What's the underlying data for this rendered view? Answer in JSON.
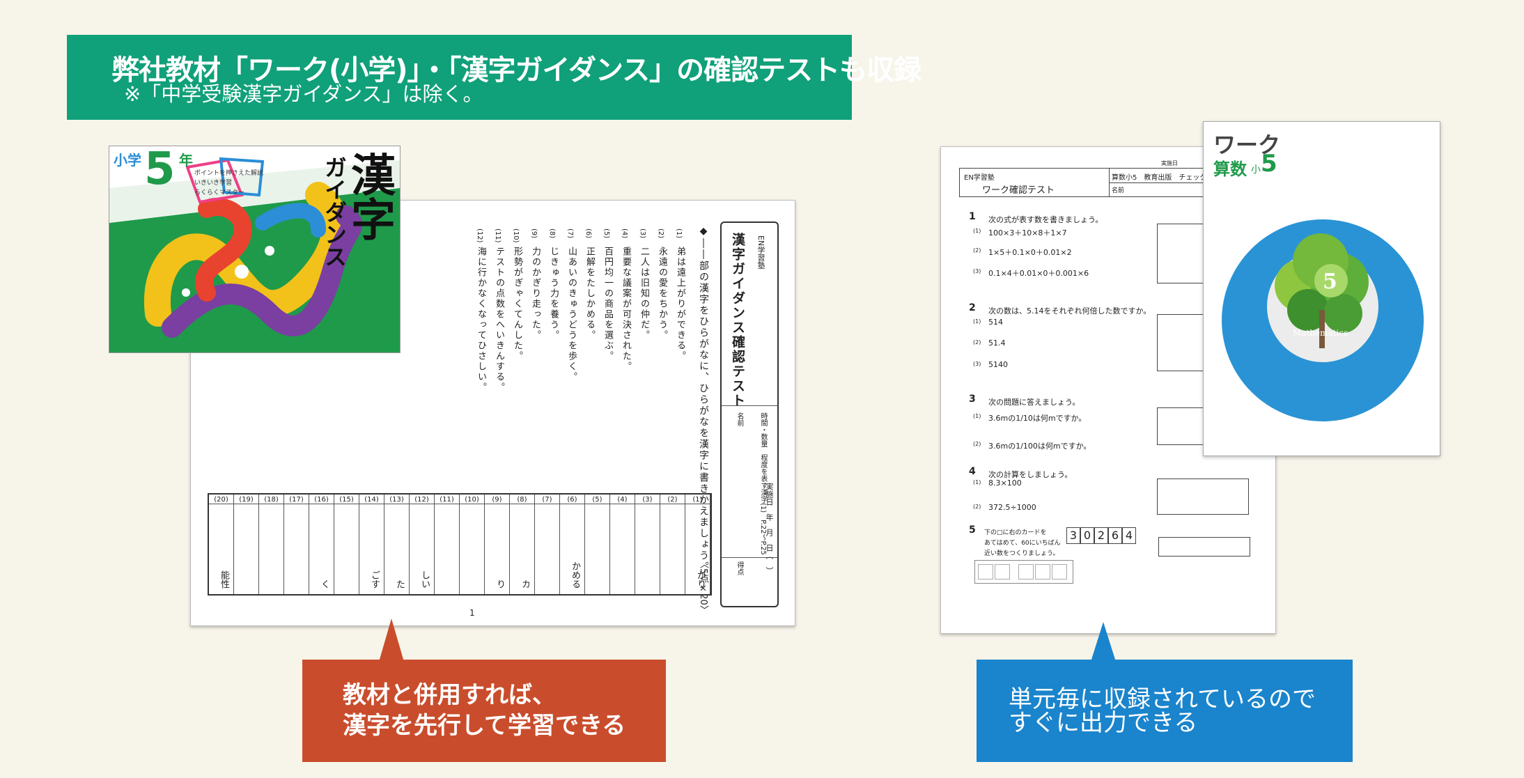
{
  "banner": {
    "title": "弊社教材「ワーク(小学)」・「漢字ガイダンス」の確認テストも収録",
    "note": "※「中学受験漢字ガイダンス」は除く。"
  },
  "kanji_book": {
    "grade_label": "小学",
    "grade_number": "5",
    "grade_suffix": "年",
    "title_main": "漢字",
    "title_sub": "ガイダンス",
    "points": [
      "ポイントを押さえた解説",
      "いきいき学習",
      "らくらくマスター"
    ]
  },
  "kanji_test": {
    "publisher": "EN学習塾",
    "title": "漢字ガイダンス確認テスト",
    "instruction": "◆――部の漢字をひらがなに、ひらがなを漢字に書きかえましょう。",
    "score_note": "〈5点×20〉",
    "name_label": "名前",
    "points_label": "得点",
    "date_label": "実施日　年　月　日（　）",
    "range_label": "時間・数量　程度を表す漢字(1)　P.22〜P.25",
    "page_number": "1",
    "questions": [
      {
        "num": "(1)",
        "text": "弟は遠上がりができる。"
      },
      {
        "num": "(2)",
        "text": "永遠の愛をちかう。"
      },
      {
        "num": "(3)",
        "text": "二人は旧知の仲だ。"
      },
      {
        "num": "(4)",
        "text": "重要な議案が可決された。"
      },
      {
        "num": "(5)",
        "text": "百円均一の商品を選ぶ。"
      },
      {
        "num": "(6)",
        "text": "正解をたしかめる。"
      },
      {
        "num": "(7)",
        "text": "山あいのきゅうどうを歩く。"
      },
      {
        "num": "(8)",
        "text": "じきゅう力を養う。"
      },
      {
        "num": "(9)",
        "text": "力のかぎり走った。"
      },
      {
        "num": "(10)",
        "text": "形勢がぎゃくてんした。"
      },
      {
        "num": "(11)",
        "text": "テストの点数をへいきんする。"
      },
      {
        "num": "(12)",
        "text": "海に行かなくなってひさしい。"
      }
    ],
    "answer_nums": [
      "(20)",
      "(19)",
      "(18)",
      "(17)",
      "(16)",
      "(15)",
      "(14)",
      "(13)",
      "(12)",
      "(11)",
      "(10)",
      "(9)",
      "(8)",
      "(7)",
      "(6)",
      "(5)",
      "(4)",
      "(3)",
      "(2)",
      "(1)"
    ],
    "answers": [
      "能性",
      "",
      "",
      "",
      "く",
      "",
      "ごす",
      "た",
      "しい",
      "",
      "",
      "り",
      "カ",
      "",
      "かめる",
      "",
      "",
      "",
      "",
      "がり"
    ]
  },
  "math_test": {
    "publisher": "EN学習塾",
    "title": "ワーク確認テスト",
    "header_right": "算数小5　教育出版　チェック１",
    "date_label": "実施日",
    "name_label": "名前",
    "q1": {
      "num": "1",
      "text": "次の式が表す数を書きましょう。",
      "items": [
        "100×3＋10×8＋1×7",
        "1×5＋0.1×0＋0.01×2",
        "0.1×4＋0.01×0＋0.001×6"
      ]
    },
    "q2": {
      "num": "2",
      "text": "次の数は、5.14をそれぞれ何倍した数ですか。",
      "items": [
        "514",
        "51.4",
        "5140"
      ]
    },
    "q3": {
      "num": "3",
      "text": "次の問題に答えましょう。",
      "items": [
        "3.6mの1/10は何mですか。",
        "3.6mの1/100は何mですか。"
      ]
    },
    "q4": {
      "num": "4",
      "text": "次の計算をしましょう。",
      "items": [
        "8.3×100",
        "372.5÷1000"
      ]
    },
    "q5": {
      "num": "5",
      "text_lines": [
        "下の□に右のカードを",
        "あてはめて、60にいちばん",
        "近い数をつくりましょう。"
      ],
      "cards": [
        "3",
        "0",
        "2",
        "6",
        "4"
      ]
    },
    "item_nums": [
      "(1)",
      "(2)",
      "(3)"
    ]
  },
  "work_book": {
    "title": "ワーク",
    "subject": "算数",
    "grade_prefix": "小",
    "grade": "5",
    "tree_number": "5",
    "tree_label": "Mathematics"
  },
  "callouts": {
    "left_line1": "教材と併用すれば、",
    "left_line2": "漢字を先行して学習できる",
    "right_line1": "単元毎に収録されているので",
    "right_line2": "すぐに出力できる"
  },
  "colors": {
    "banner": "#10a07a",
    "left_callout": "#c94d2c",
    "right_callout": "#1a84cc",
    "book_blue": "#2a93d5"
  }
}
